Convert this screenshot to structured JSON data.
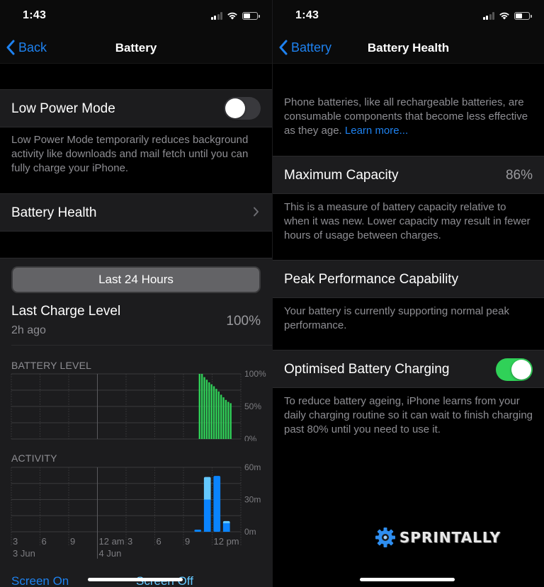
{
  "left_screen": {
    "status_bar": {
      "time": "1:43",
      "signal_bars": 2,
      "signal_total": 4,
      "battery_fill_fraction": 0.5
    },
    "nav": {
      "back_label": "Back",
      "title": "Battery"
    },
    "low_power_mode": {
      "label": "Low Power Mode",
      "enabled": false,
      "footnote": "Low Power Mode temporarily reduces background activity like downloads and mail fetch until you can fully charge your iPhone."
    },
    "battery_health_row": {
      "label": "Battery Health"
    },
    "usage": {
      "segmented_label": "Last 24 Hours",
      "last_charge": {
        "label": "Last Charge Level",
        "sub": "2h ago",
        "value": "100%"
      },
      "legend": {
        "screen_on": "Screen On",
        "screen_off": "Screen Off"
      }
    }
  },
  "right_screen": {
    "status_bar": {
      "time": "1:43",
      "signal_bars": 2,
      "signal_total": 4,
      "battery_fill_fraction": 0.5
    },
    "nav": {
      "back_label": "Battery",
      "title": "Battery Health"
    },
    "intro": {
      "text": "Phone batteries, like all rechargeable batteries, are consumable components that become less effective as they age. ",
      "link": "Learn more..."
    },
    "maximum_capacity": {
      "label": "Maximum Capacity",
      "value": "86%",
      "footnote": "This is a measure of battery capacity relative to when it was new. Lower capacity may result in fewer hours of usage between charges."
    },
    "peak_performance": {
      "label": "Peak Performance Capability",
      "footnote": "Your battery is currently supporting normal peak performance."
    },
    "optimised_charging": {
      "label": "Optimised Battery Charging",
      "enabled": true,
      "footnote": "To reduce battery ageing, iPhone learns from your daily charging routine so it can wait to finish charging past 80% until you need to use it."
    },
    "watermark": "SPRINTALLY"
  },
  "colors": {
    "accent_blue": "#1e82f0",
    "battery_green": "#30d158",
    "screen_on_blue": "#0a84ff",
    "screen_off_blue": "#64c8ff",
    "toggle_on": "#30d158"
  },
  "chart_data": [
    {
      "type": "bar",
      "title": "BATTERY LEVEL",
      "xlabel": "",
      "ylabel": "",
      "x_range_hours": [
        0,
        24
      ],
      "x_tick_labels": [
        "3",
        "6",
        "9",
        "12 am",
        "3",
        "6",
        "9",
        "12 pm"
      ],
      "date_labels": [
        {
          "label": "3 Jun",
          "at_tick": 0
        },
        {
          "label": "4 Jun",
          "at_tick": 3
        }
      ],
      "y_tick_labels": [
        "100%",
        "50%",
        "0%"
      ],
      "ylim": [
        0,
        100
      ],
      "grid": true,
      "bar_start_hour": 19.6,
      "bar_step_hours": 0.25,
      "values": [
        100,
        100,
        95,
        91,
        87,
        84,
        81,
        77,
        73,
        68,
        64,
        60,
        57,
        55
      ]
    },
    {
      "type": "bar",
      "title": "ACTIVITY",
      "xlabel": "",
      "ylabel": "",
      "x_range_hours": [
        0,
        24
      ],
      "x_tick_labels": [
        "3",
        "6",
        "9",
        "12 am",
        "3",
        "6",
        "9",
        "12 pm"
      ],
      "date_labels": [
        {
          "label": "3 Jun",
          "at_tick": 0
        },
        {
          "label": "4 Jun",
          "at_tick": 3
        }
      ],
      "y_tick_labels": [
        "60m",
        "30m",
        "0m"
      ],
      "ylim": [
        0,
        60
      ],
      "grid": true,
      "stacked": true,
      "hours": [
        19,
        20,
        21,
        22
      ],
      "series": [
        {
          "name": "Screen On",
          "values": [
            2,
            30,
            52,
            8
          ]
        },
        {
          "name": "Screen Off",
          "values": [
            0,
            21,
            0,
            2
          ]
        }
      ],
      "legend": [
        "Screen On",
        "Screen Off"
      ],
      "legend_position": "bottom"
    }
  ]
}
